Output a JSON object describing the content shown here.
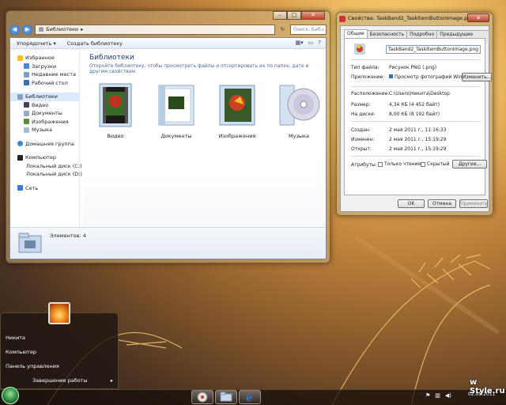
{
  "explorer": {
    "path_root": "Библиотеки",
    "search_placeholder": "Поиск: Биб...",
    "toolbar": {
      "organize": "Упорядочить",
      "new_library": "Создать библиотеку"
    },
    "nav": {
      "favorites": "Избранное",
      "downloads": "Загрузки",
      "recent": "Недавние места",
      "desktop": "Рабочий стол",
      "libraries": "Библиотеки",
      "video": "Видео",
      "documents": "Документы",
      "images": "Изображения",
      "music": "Музыка",
      "homegroup": "Домашняя группа",
      "computer": "Компьютер",
      "disk_c": "Локальный диск (C:)",
      "disk_d": "Локальный диск (D:)",
      "network": "Сеть"
    },
    "header_title": "Библиотеки",
    "header_desc": "Откройте библиотеку, чтобы просмотреть файлы и отсортировать их по папке, дате и другим свойствам.",
    "folders": [
      {
        "label": "Видео",
        "icon": "video-library-icon"
      },
      {
        "label": "Документы",
        "icon": "documents-library-icon"
      },
      {
        "label": "Изображения",
        "icon": "images-library-icon"
      },
      {
        "label": "Музыка",
        "icon": "music-library-icon"
      }
    ],
    "details": "Элементов: 4"
  },
  "props": {
    "title": "Свойства: TaskBand2_TaskItemButtonImage.png",
    "tabs": [
      "Общие",
      "Безопасность",
      "Подробно",
      "Предыдущие версии"
    ],
    "filename": "TaskBand2_TaskItemButtonImage.png",
    "labels": {
      "type": "Тип файла:",
      "app": "Приложение:",
      "location": "Расположение:",
      "size": "Размер:",
      "disk": "На диске:",
      "created": "Создан:",
      "modified": "Изменен:",
      "opened": "Открыт:",
      "attrs": "Атрибуты:"
    },
    "values": {
      "type": "Рисунок PNG (.png)",
      "app": "Просмотр фотографий Windows",
      "location": "C:\\Users\\Никита\\Desktop",
      "size": "4,34 КБ (4 452 байт)",
      "disk": "8,00 КБ (8 192 байт)",
      "created": "2 мая 2011 г., 11:16:33",
      "modified": "2 мая 2011 г., 15:19:29",
      "opened": "2 мая 2011 г., 15:19:29"
    },
    "change_btn": "Изменить...",
    "readonly": "Только чтение",
    "hidden": "Скрытый",
    "other_btn": "Другие...",
    "ok": "OK",
    "cancel": "Отмена",
    "apply": "Применить"
  },
  "start_menu": {
    "items": [
      "Никита",
      "Компьютер",
      "Панель управления"
    ],
    "shutdown": "Завершение работы"
  },
  "taskbar": {
    "date": "02.05.2011"
  },
  "watermark": "w Style.ru"
}
